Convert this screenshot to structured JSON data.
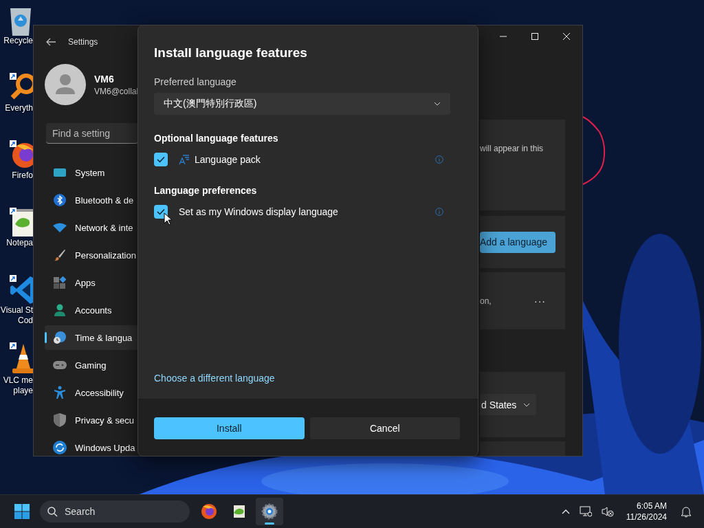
{
  "desktop_icons": [
    {
      "lines": [
        "Recycle"
      ]
    },
    {
      "lines": [
        "Everyth"
      ]
    },
    {
      "lines": [
        "Firefo"
      ]
    },
    {
      "lines": [
        "Notepa"
      ]
    },
    {
      "lines": [
        "Visual St",
        "Cod"
      ]
    },
    {
      "lines": [
        "VLC me",
        "playe"
      ]
    }
  ],
  "settings": {
    "title": "Settings",
    "user": {
      "name": "VM6",
      "email": "VM6@collal"
    },
    "search": {
      "placeholder": "Find a setting"
    },
    "nav": [
      {
        "label": "System",
        "selected": false
      },
      {
        "label": "Bluetooth & de",
        "selected": false
      },
      {
        "label": "Network & inte",
        "selected": false
      },
      {
        "label": "Personalization",
        "selected": false
      },
      {
        "label": "Apps",
        "selected": false
      },
      {
        "label": "Accounts",
        "selected": false
      },
      {
        "label": "Time & langua",
        "selected": true
      },
      {
        "label": "Gaming",
        "selected": false
      },
      {
        "label": "Accessibility",
        "selected": false
      },
      {
        "label": "Privacy & secu",
        "selected": false
      },
      {
        "label": "Windows Upda",
        "selected": false
      }
    ],
    "content": {
      "info_text": "will appear in this",
      "add_button": "Add a language",
      "language_text": "on,",
      "more_button": "···",
      "region_dropdown": "d States"
    }
  },
  "dialog": {
    "title": "Install language features",
    "preferred_label": "Preferred language",
    "preferred_value": "中文(澳門特別行政區)",
    "sections": [
      {
        "heading": "Optional language features",
        "items": [
          {
            "label": "Language pack",
            "checked": true,
            "kind": "feature"
          }
        ]
      },
      {
        "heading": "Language preferences",
        "items": [
          {
            "label": "Set as my Windows display language",
            "checked": true,
            "kind": "preference"
          }
        ]
      }
    ],
    "link": "Choose a different language",
    "buttons": [
      {
        "label": "Install",
        "kind": "primary"
      },
      {
        "label": "Cancel",
        "kind": "secondary"
      }
    ]
  },
  "taskbar": {
    "search": {
      "placeholder": "Search"
    },
    "apps": [
      {
        "selected": false
      },
      {
        "selected": false
      },
      {
        "selected": true
      }
    ],
    "time": "6:05 AM",
    "date": "11/26/2024"
  }
}
